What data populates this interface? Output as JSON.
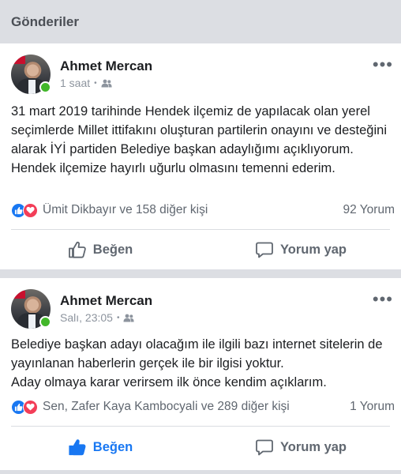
{
  "header": {
    "title": "Gönderiler"
  },
  "posts": [
    {
      "author": "Ahmet Mercan",
      "time": "1 saat",
      "audience_icon": "friends-icon",
      "text": "31 mart 2019 tarihinde Hendek ilçemiz de yapılacak olan yerel seçimlerde Millet ittifakını oluşturan partilerin onayını ve desteğini alarak İYİ partiden Belediye başkan adaylığımı açıklıyorum.\n   Hendek ilçemize hayırlı uğurlu olmasını temenni ederim.",
      "reactions": "Ümit Dikbayır ve 158 diğer kişi",
      "comments": "92 Yorum",
      "like_label": "Beğen",
      "comment_label": "Yorum yap",
      "liked": false
    },
    {
      "author": "Ahmet Mercan",
      "time": "Salı, 23:05",
      "audience_icon": "friends-icon",
      "text": "Belediye başkan adayı olacağım ile ilgili bazı internet sitelerin de yayınlanan haberlerin gerçek ile bir ilgisi yoktur.\n Aday olmaya karar verirsem ilk önce  kendim açıklarım.",
      "reactions": "Sen, Zafer Kaya Kambocyali ve 289 diğer kişi",
      "comments": "1 Yorum",
      "like_label": "Beğen",
      "comment_label": "Yorum yap",
      "liked": true
    }
  ],
  "colors": {
    "accent": "#1877f2",
    "love": "#f33e58",
    "online": "#42b72a",
    "background": "#dcdee3"
  }
}
